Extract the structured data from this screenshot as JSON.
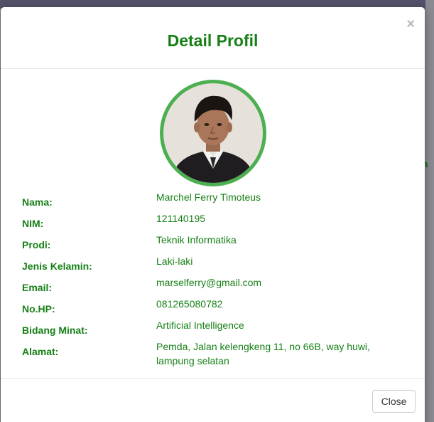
{
  "modal": {
    "title": "Detail Profil",
    "close_icon": "×",
    "close_button_label": "Close"
  },
  "background": {
    "peek_text": "ea"
  },
  "profile": {
    "fields": [
      {
        "label": "Nama:",
        "value": "Marchel Ferry Timoteus"
      },
      {
        "label": "NIM:",
        "value": "121140195"
      },
      {
        "label": "Prodi:",
        "value": "Teknik Informatika"
      },
      {
        "label": "Jenis Kelamin:",
        "value": "Laki-laki"
      },
      {
        "label": "Email:",
        "value": "marselferry@gmail.com"
      },
      {
        "label": "No.HP:",
        "value": "081265080782"
      },
      {
        "label": "Bidang Minat:",
        "value": "Artificial Intelligence"
      },
      {
        "label": "Alamat:",
        "value": "Pemda, Jalan kelengkeng 11, no 66B, way huwi, lampung selatan"
      }
    ]
  },
  "colors": {
    "accent_green": "#168016",
    "avatar_ring": "#4caf50"
  }
}
